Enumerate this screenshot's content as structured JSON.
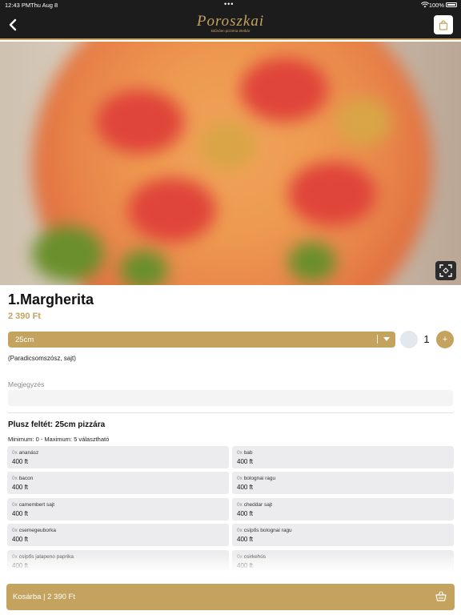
{
  "status_bar": {
    "time": "12:43 PM",
    "date": "Thu Aug 8",
    "dots": "•••",
    "battery": "100%"
  },
  "header": {
    "back_icon": "chevron-left-icon",
    "logo_title": "Poroszkai",
    "logo_tagline": "kitűnően pizzéria ételbár",
    "cart_icon": "shopping-bag-icon"
  },
  "hero": {
    "expand_icon": "expand-icon"
  },
  "product": {
    "name": "1.Margherita",
    "price": "2 390 Ft",
    "size": "25cm",
    "quantity": "1",
    "plus": "+",
    "ingredients": "(Paradicsomszósz, sajt)"
  },
  "note": {
    "label": "Megjegyzés",
    "value": ""
  },
  "extras": {
    "title": "Plusz feltét: 25cm pizzára",
    "limit": "Minimum: 0 - Maximum: 5 választható",
    "items": [
      {
        "count": "0x",
        "name": "ananász",
        "price": "400 ft"
      },
      {
        "count": "0x",
        "name": "bab",
        "price": "400 ft"
      },
      {
        "count": "0x",
        "name": "bacon",
        "price": "400 ft"
      },
      {
        "count": "0x",
        "name": "bolognai ragu",
        "price": "400 ft"
      },
      {
        "count": "0x",
        "name": "camembert sajt",
        "price": "400 ft"
      },
      {
        "count": "0x",
        "name": "cheddar sajt",
        "price": "400 ft"
      },
      {
        "count": "0x",
        "name": "csemegeuborka",
        "price": "400 ft"
      },
      {
        "count": "0x",
        "name": "csípős bolognai ragu",
        "price": "400 ft"
      },
      {
        "count": "0x",
        "name": "csípős jalapeno paprika",
        "price": "400 ft"
      },
      {
        "count": "0x",
        "name": "csirkehús",
        "price": "400 ft"
      }
    ]
  },
  "cart_button": {
    "label": "Kosárba | 2 390 Ft",
    "icon": "basket-icon"
  },
  "colors": {
    "accent": "#c4a35f",
    "header_bg": "#1c1c1c",
    "chip_bg": "#ececee"
  }
}
